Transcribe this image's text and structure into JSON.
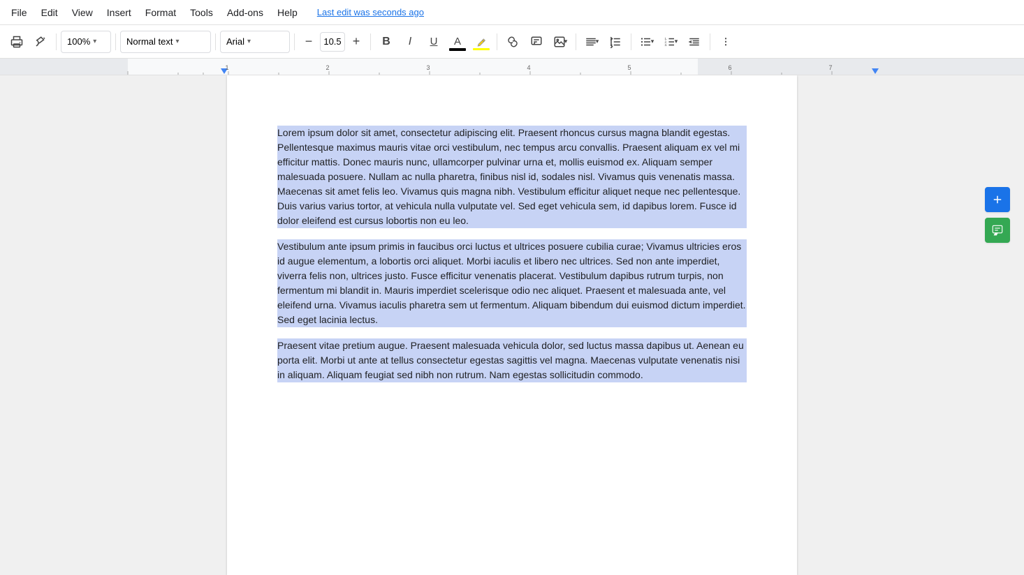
{
  "menu": {
    "items": [
      "File",
      "Edit",
      "View",
      "Insert",
      "Format",
      "Tools",
      "Add-ons",
      "Help"
    ],
    "last_edit": "Last edit was seconds ago"
  },
  "toolbar": {
    "zoom": "100%",
    "style": "Normal text",
    "font": "Arial",
    "font_size": "10.5",
    "print_label": "🖨",
    "paint_format_label": "🎨",
    "bold_label": "B",
    "italic_label": "I",
    "underline_label": "U",
    "text_color_label": "A",
    "highlight_label": "✏",
    "link_label": "🔗",
    "comment_label": "💬",
    "image_label": "🖼",
    "align_label": "≡",
    "line_spacing_label": "↕",
    "bullet_label": "≔",
    "number_label": "⒈",
    "indent_label": "⇥",
    "minus_label": "−",
    "plus_label": "+"
  },
  "document": {
    "paragraphs": [
      "Lorem ipsum dolor sit amet, consectetur adipiscing elit. Praesent rhoncus cursus magna blandit egestas. Pellentesque maximus mauris vitae orci vestibulum, nec tempus arcu convallis. Praesent aliquam ex vel mi efficitur mattis. Donec mauris nunc, ullamcorper pulvinar urna et, mollis euismod ex. Aliquam semper malesuada posuere. Nullam ac nulla pharetra, finibus nisl id, sodales nisl. Vivamus quis venenatis massa. Maecenas sit amet felis leo. Vivamus quis magna nibh. Vestibulum efficitur aliquet neque nec pellentesque. Duis varius varius tortor, at vehicula nulla vulputate vel. Sed eget vehicula sem, id dapibus lorem. Fusce id dolor eleifend est cursus lobortis non eu leo.",
      "Vestibulum ante ipsum primis in faucibus orci luctus et ultrices posuere cubilia curae; Vivamus ultricies eros id augue elementum, a lobortis orci aliquet. Morbi iaculis et libero nec ultrices. Sed non ante imperdiet, viverra felis non, ultrices justo. Fusce efficitur venenatis placerat. Vestibulum dapibus rutrum turpis, non fermentum mi blandit in. Mauris imperdiet scelerisque odio nec aliquet. Praesent et malesuada ante, vel eleifend urna. Vivamus iaculis pharetra sem ut fermentum. Aliquam bibendum dui euismod dictum imperdiet. Sed eget lacinia lectus.",
      "Praesent vitae pretium augue. Praesent malesuada vehicula dolor, sed luctus massa dapibus ut. Aenean eu porta elit. Morbi ut ante at tellus consectetur egestas sagittis vel magna. Maecenas vulputate venenatis nisi in aliquam. Aliquam feugiat sed nibh non rutrum. Nam egestas sollicitudin commodo."
    ]
  },
  "side_buttons": {
    "add_label": "+",
    "comment_label": "✎"
  }
}
